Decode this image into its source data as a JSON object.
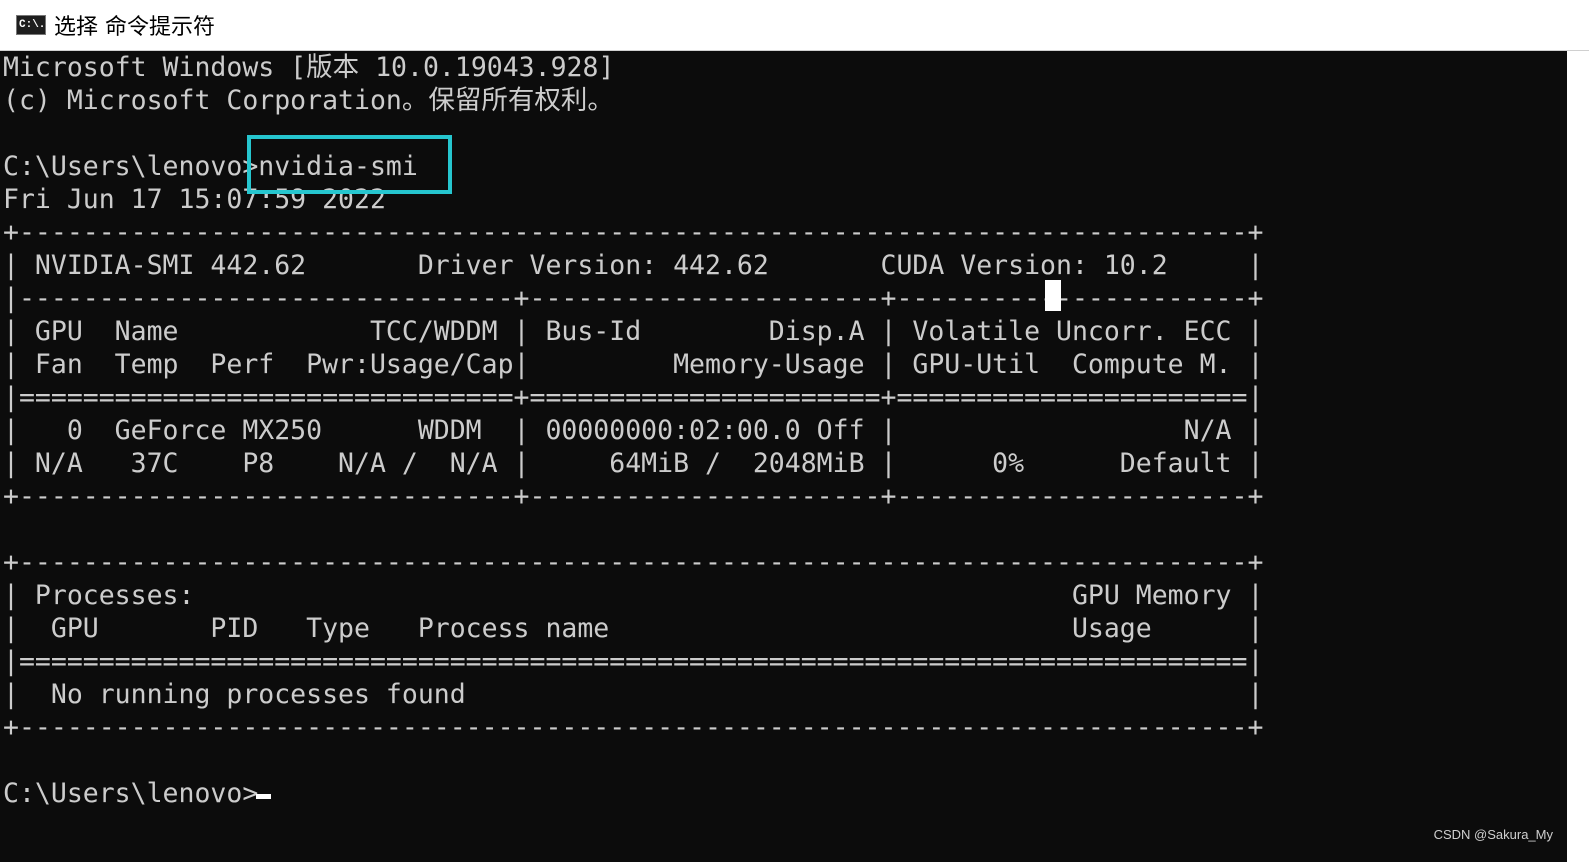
{
  "window": {
    "title": "选择 命令提示符",
    "icon": "cmd-icon",
    "icon_text": "C:\\."
  },
  "console": {
    "lines": [
      "Microsoft Windows [版本 10.0.19043.928]",
      "(c) Microsoft Corporation。保留所有权利。",
      "",
      "C:\\Users\\lenovo>nvidia-smi",
      "Fri Jun 17 15:07:59 2022",
      "+-----------------------------------------------------------------------------+",
      "| NVIDIA-SMI 442.62       Driver Version: 442.62       CUDA Version: 10.2     |",
      "|-------------------------------+----------------------+----------------------+",
      "| GPU  Name            TCC/WDDM | Bus-Id        Disp.A | Volatile Uncorr. ECC |",
      "| Fan  Temp  Perf  Pwr:Usage/Cap|         Memory-Usage | GPU-Util  Compute M. |",
      "|===============================+======================+======================|",
      "|   0  GeForce MX250      WDDM  | 00000000:02:00.0 Off |                  N/A |",
      "| N/A   37C    P8    N/A /  N/A |     64MiB /  2048MiB |      0%      Default |",
      "+-------------------------------+----------------------+----------------------+",
      "",
      "+-----------------------------------------------------------------------------+",
      "| Processes:                                                       GPU Memory |",
      "|  GPU       PID   Type   Process name                             Usage      |",
      "|=============================================================================|",
      "|  No running processes found                                                 |",
      "+-----------------------------------------------------------------------------+",
      "",
      "C:\\Users\\lenovo>"
    ]
  },
  "watermark": "CSDN @Sakura_My",
  "colors": {
    "console_bg": "#0c0c0c",
    "console_text": "#cccccc",
    "highlight": "#26c6cf",
    "titlebar_bg": "#ffffff"
  }
}
